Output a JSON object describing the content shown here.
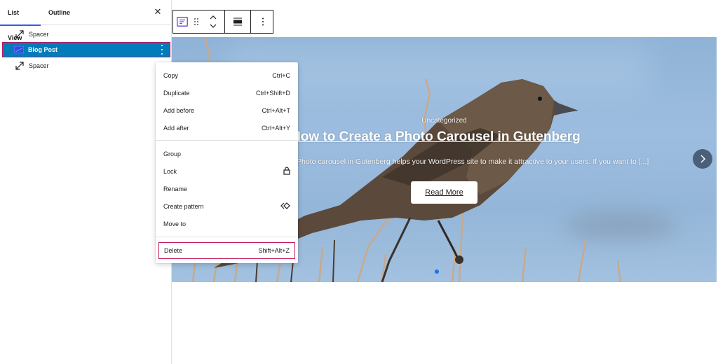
{
  "sidebar": {
    "tabs": [
      {
        "label": "List View",
        "active": true
      },
      {
        "label": "Outline",
        "active": false
      }
    ],
    "close_icon": "close-icon",
    "items": [
      {
        "label": "Spacer",
        "icon": "resize-arrows-icon",
        "selected": false
      },
      {
        "label": "Blog Post",
        "icon": "post-block-icon",
        "selected": true
      },
      {
        "label": "Spacer",
        "icon": "resize-arrows-icon",
        "selected": false
      }
    ]
  },
  "toolbar": {
    "buttons": [
      "block-type-icon",
      "drag-handle-icon",
      "move-up-down-icon",
      "align-icon",
      "more-options-icon"
    ]
  },
  "context_menu": {
    "groups": [
      [
        {
          "label": "Copy",
          "shortcut": "Ctrl+C"
        },
        {
          "label": "Duplicate",
          "shortcut": "Ctrl+Shift+D"
        },
        {
          "label": "Add before",
          "shortcut": "Ctrl+Alt+T"
        },
        {
          "label": "Add after",
          "shortcut": "Ctrl+Alt+Y"
        }
      ],
      [
        {
          "label": "Group",
          "shortcut": ""
        },
        {
          "label": "Lock",
          "icon": "lock-icon"
        },
        {
          "label": "Rename",
          "shortcut": ""
        },
        {
          "label": "Create pattern",
          "icon": "pattern-icon"
        },
        {
          "label": "Move to",
          "shortcut": ""
        }
      ],
      [
        {
          "label": "Delete",
          "shortcut": "Shift+Alt+Z",
          "highlighted": true
        }
      ]
    ]
  },
  "hero": {
    "category": "Uncategorized",
    "title": "How to Create a Photo Carousel in Gutenberg",
    "excerpt": "Photo carousel in Gutenberg helps your WordPress site to make it attractive to your users. If you want to [...]",
    "read_more": "Read More",
    "next_icon": "chevron-right-icon",
    "slide_count_visible_dots": 1
  },
  "colors": {
    "accent": "#007cba",
    "highlight_border": "#c2185b",
    "tab_indicator": "#3858e9",
    "dot": "#1a73e8"
  }
}
